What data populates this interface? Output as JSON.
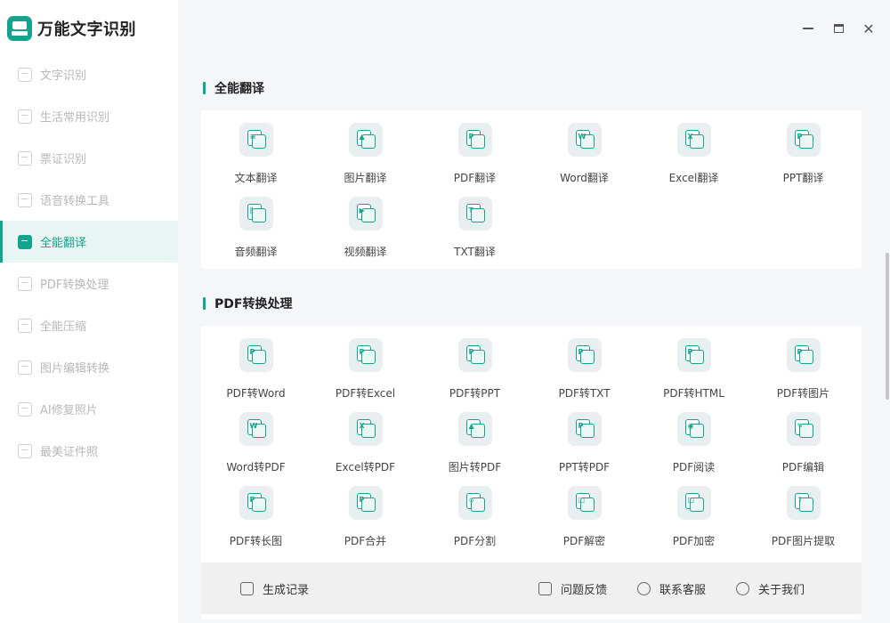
{
  "app": {
    "title": "万能文字识别",
    "brand_color": "#12a48d"
  },
  "sidebar": {
    "items": [
      {
        "label": "文字识别",
        "icon": "scan-text-icon"
      },
      {
        "label": "生活常用识别",
        "icon": "scan-life-icon"
      },
      {
        "label": "票证识别",
        "icon": "scan-ticket-icon"
      },
      {
        "label": "语音转换工具",
        "icon": "voice-convert-icon"
      },
      {
        "label": "全能翻译",
        "icon": "translate-icon",
        "active": true
      },
      {
        "label": "PDF转换处理",
        "icon": "pdf-convert-icon"
      },
      {
        "label": "全能压缩",
        "icon": "compress-icon"
      },
      {
        "label": "图片编辑转换",
        "icon": "image-edit-icon"
      },
      {
        "label": "AI修复照片",
        "icon": "ai-repair-icon"
      },
      {
        "label": "最美证件照",
        "icon": "id-photo-icon"
      }
    ]
  },
  "window": {
    "minimize": "minimize-icon",
    "maximize": "maximize-icon",
    "close": "close-icon",
    "close_glyph": "✕"
  },
  "translate_section": {
    "title": "全能翻译",
    "tools": [
      {
        "label": "文本翻译",
        "mark": "≡"
      },
      {
        "label": "图片翻译",
        "mark": "▲"
      },
      {
        "label": "PDF翻译",
        "mark": "P"
      },
      {
        "label": "Word翻译",
        "mark": "W"
      },
      {
        "label": "Excel翻译",
        "mark": "X"
      },
      {
        "label": "PPT翻译",
        "mark": "P"
      },
      {
        "label": "音频翻译",
        "mark": "∥"
      },
      {
        "label": "视频翻译",
        "mark": "▶"
      },
      {
        "label": "TXT翻译",
        "mark": "T"
      }
    ]
  },
  "pdf_section": {
    "title": "PDF转换处理",
    "tools": [
      {
        "label": "PDF转Word",
        "mark": "P"
      },
      {
        "label": "PDF转Excel",
        "mark": "P"
      },
      {
        "label": "PDF转PPT",
        "mark": "P"
      },
      {
        "label": "PDF转TXT",
        "mark": "P"
      },
      {
        "label": "PDF转HTML",
        "mark": "P"
      },
      {
        "label": "PDF转图片",
        "mark": "P"
      },
      {
        "label": "Word转PDF",
        "mark": "W"
      },
      {
        "label": "Excel转PDF",
        "mark": "X"
      },
      {
        "label": "图片转PDF",
        "mark": "▲"
      },
      {
        "label": "PPT转PDF",
        "mark": "P"
      },
      {
        "label": "PDF阅读",
        "mark": "◉"
      },
      {
        "label": "PDF编辑",
        "mark": "✎"
      },
      {
        "label": "PDF转长图",
        "mark": "P"
      },
      {
        "label": "PDF合并",
        "mark": "P"
      },
      {
        "label": "PDF分割",
        "mark": "◇"
      },
      {
        "label": "PDF解密",
        "mark": "□"
      },
      {
        "label": "PDF加密",
        "mark": "□"
      },
      {
        "label": "PDF图片提取",
        "mark": "↑"
      }
    ]
  },
  "bottom_bar": {
    "records": "生成记录",
    "feedback": "问题反馈",
    "service": "联系客服",
    "about": "关于我们"
  }
}
